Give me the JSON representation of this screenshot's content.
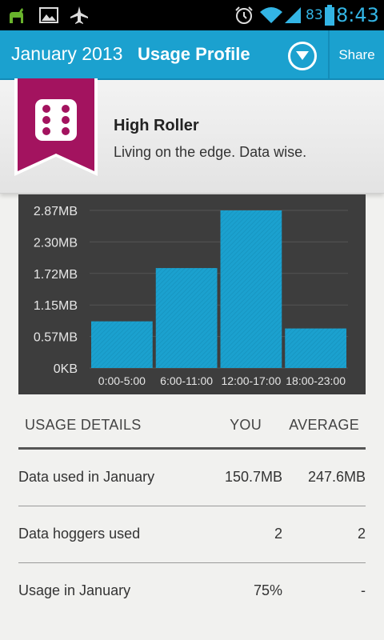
{
  "status_bar": {
    "battery_level": "83",
    "time": "8:43",
    "icons": [
      "android-notification-icon",
      "image-icon",
      "airplane-icon",
      "alarm-icon",
      "wifi-icon",
      "signal-icon",
      "battery-icon"
    ],
    "accent_color": "#33b5e5"
  },
  "action_bar": {
    "month": "January 2013",
    "title": "Usage Profile",
    "share_label": "Share",
    "dropdown_icon": "chevron-down-circle-icon",
    "color": "#1ba1cf"
  },
  "profile": {
    "name": "High Roller",
    "tagline": "Living on the edge. Data wise.",
    "badge_icon": "dice-icon",
    "badge_color": "#a3135f"
  },
  "chart_data": {
    "type": "bar",
    "categories": [
      "0:00-5:00",
      "6:00-11:00",
      "12:00-17:00",
      "18:00-23:00"
    ],
    "values": [
      0.85,
      1.82,
      2.87,
      0.72
    ],
    "y_tick_labels": [
      "0KB",
      "0.57MB",
      "1.15MB",
      "1.72MB",
      "2.30MB",
      "2.87MB"
    ],
    "y_ticks": [
      0,
      0.574,
      1.148,
      1.722,
      2.296,
      2.87
    ],
    "ylim": [
      0,
      2.87
    ],
    "unit": "MB",
    "grid": true,
    "bar_color": "#1ba1cf",
    "background": "#3d3d3d"
  },
  "details": {
    "headers": {
      "label": "USAGE DETAILS",
      "you": "YOU",
      "average": "AVERAGE"
    },
    "rows": [
      {
        "label": "Data used in January",
        "you": "150.7MB",
        "average": "247.6MB"
      },
      {
        "label": "Data hoggers used",
        "you": "2",
        "average": "2"
      },
      {
        "label": "Usage in January",
        "you": "75%",
        "average": "-"
      }
    ]
  }
}
